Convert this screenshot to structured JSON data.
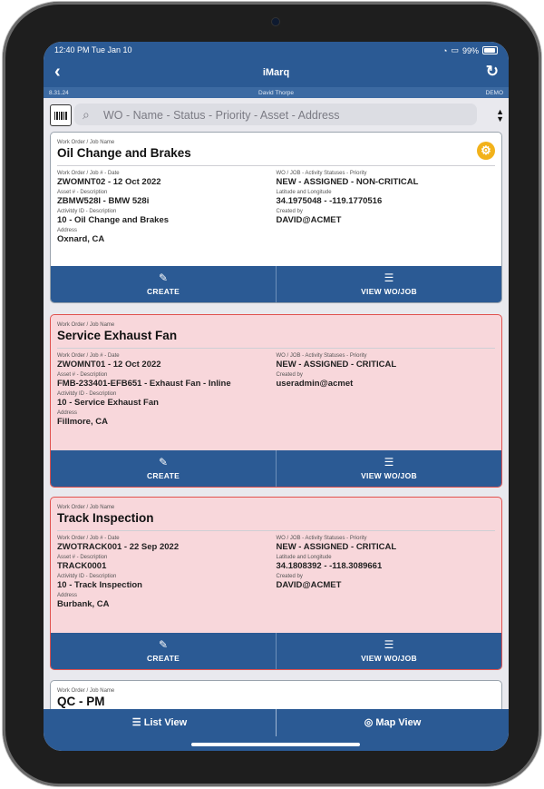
{
  "status_bar": {
    "time": "12:40 PM  Tue Jan 10",
    "battery": "99%"
  },
  "nav": {
    "title": "iMarq",
    "back_icon": "chevron-left-icon",
    "refresh_icon": "refresh-icon"
  },
  "sub_bar": {
    "version": "8.31.24",
    "user": "David Thorpe",
    "env": "DEMO"
  },
  "search": {
    "placeholder": "WO - Name - Status - Priority - Asset - Address"
  },
  "labels": {
    "job_name": "Work Order / Job Name",
    "wo_date": "Work Order / Job # - Date",
    "statuses": "WO / JOB - Activity Statuses - Priority",
    "asset": "Asset # - Description",
    "latlong": "Latitude and Longitude",
    "activity": "Activitdy ID - Description",
    "created_by": "Created by",
    "address": "Address"
  },
  "actions": {
    "create": "CREATE",
    "view": "VIEW WO/JOB"
  },
  "cards": [
    {
      "name": "Oil Change and Brakes",
      "wo_date": "ZWOMNT02 - 12 Oct 2022",
      "statuses": "NEW - ASSIGNED - NON-CRITICAL",
      "asset": "ZBMW528I - BMW 528i",
      "latlong": "34.1975048 - -119.1770516",
      "activity": "10 - Oil Change and Brakes",
      "created_by": "DAVID@ACMET",
      "address": "Oxnard, CA",
      "critical": false
    },
    {
      "name": "Service Exhaust Fan",
      "wo_date": "ZWOMNT01 - 12 Oct 2022",
      "statuses": "NEW - ASSIGNED - CRITICAL",
      "asset": "FMB-233401-EFB651 - Exhaust Fan - Inline",
      "created_by": "useradmin@acmet",
      "activity": "10 - Service Exhaust Fan",
      "address": "Fillmore, CA",
      "critical": true
    },
    {
      "name": "Track Inspection",
      "wo_date": "ZWOTRACK001 - 22 Sep 2022",
      "statuses": "NEW - ASSIGNED - CRITICAL",
      "asset": "TRACK0001",
      "latlong": "34.1808392 - -118.3089661",
      "activity": "10 - Track Inspection",
      "created_by": "DAVID@ACMET",
      "address": "Burbank, CA",
      "critical": true
    },
    {
      "name": "QC - PM"
    }
  ],
  "bottom_tabs": {
    "list": "List View",
    "map": "Map View"
  }
}
